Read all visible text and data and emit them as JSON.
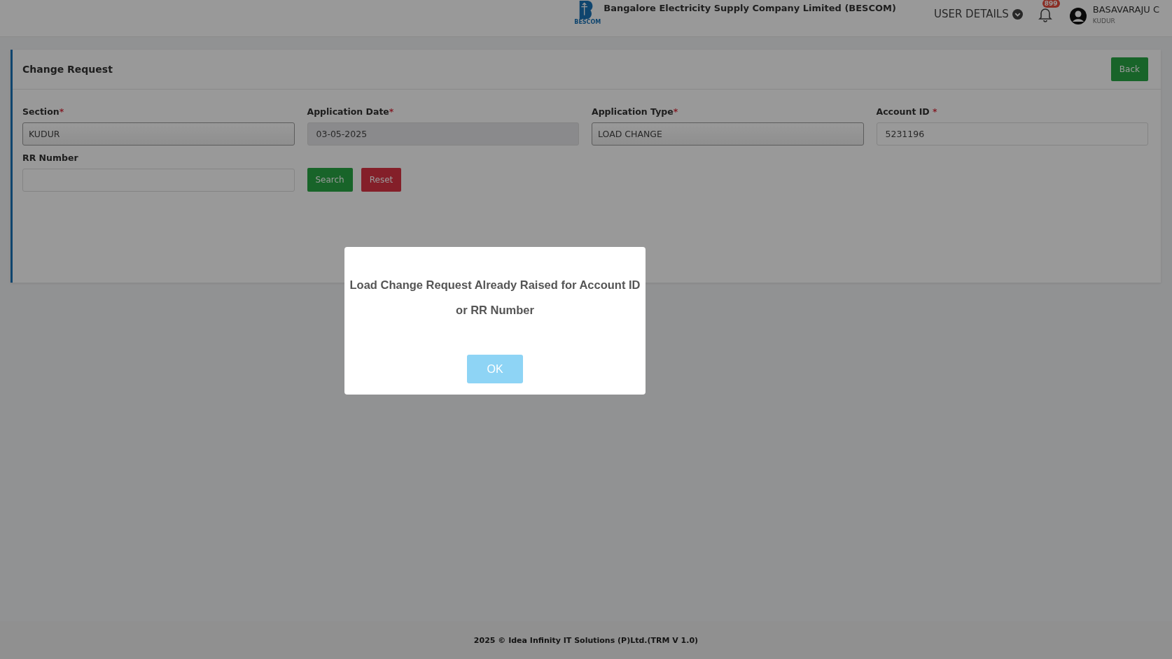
{
  "header": {
    "logo_caption": "BESCOM",
    "company": "Bangalore Electricity Supply Company Limited (BESCOM)",
    "user_details": "USER DETAILS",
    "notifications": "899",
    "user_name": "BASAVARAJU C",
    "user_section": "KUDUR"
  },
  "card": {
    "title": "Change Request",
    "back_button": "Back",
    "fields": [
      {
        "label": "Section",
        "required": "*",
        "kind": "select",
        "value": "KUDUR",
        "disabled": false
      },
      {
        "label": "Application Date",
        "required": "*",
        "kind": "input",
        "value": "03-05-2025",
        "disabled": true
      },
      {
        "label": "Application Type",
        "required": "*",
        "kind": "select",
        "value": "LOAD CHANGE",
        "disabled": false
      },
      {
        "label": "Account ID",
        "required": "*",
        "kind": "input",
        "value": "5231196",
        "disabled": false
      },
      {
        "label": "RR Number",
        "kind": "input",
        "disabled": false
      }
    ],
    "buttons": [
      {
        "label": "Search",
        "kind": "primary"
      },
      {
        "label": "Reset",
        "kind": "danger"
      }
    ]
  },
  "dialog": {
    "message": "Load Change Request Already Raised for Account ID or RR Number",
    "button": "OK"
  },
  "footer": "2025 © Idea Infinity IT Solutions (P)Ltd.(TRM V 1.0)"
}
